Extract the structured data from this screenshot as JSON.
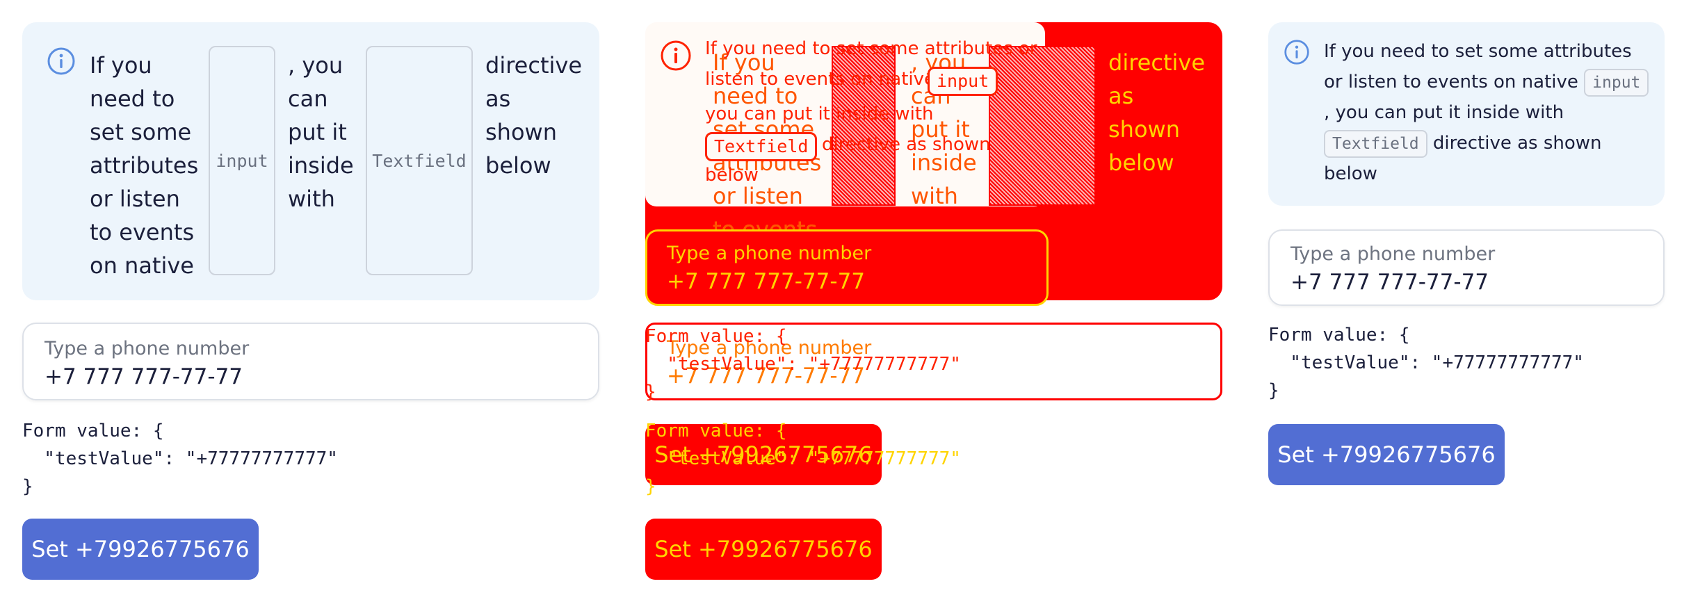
{
  "colors": {
    "notification_bg": "#edf5fc",
    "accent": "#526ed3",
    "info_icon": "#5b8ee0",
    "debug_red": "#ff0000",
    "debug_yellow": "#ffd400"
  },
  "icons": {
    "info": "info-circle-icon"
  },
  "narrow": {
    "notification": {
      "col1": "If you\nneed to\nset some\nattributes\nor listen\nto events\non native",
      "code1": "input",
      "col2": ", you\ncan\nput it\ninside\nwith",
      "code2": "Textfield",
      "col3": "directive\nas\nshown\nbelow"
    },
    "phone_field": {
      "label": "Type a phone number",
      "value": "+7 777 777-77-77"
    },
    "form_value": "Form value: {\n  \"testValue\": \"+77777777777\"\n}",
    "button_label": "Set +79926775676"
  },
  "overlay": {
    "notification_line1": "If you need to set some attributes or",
    "notification_line2a": "listen to events on native",
    "notification_code1": "input",
    "notification_line3": "you can put it inside with",
    "notification_code2": "Textfield",
    "notification_line4a": "directive as shown",
    "notification_line5": "below",
    "col1": "If you\nneed to\nset some\nattributes\nor listen\nto events\non native",
    "code1": "input",
    "col2": ", you\ncan\nput it\ninside\nwith",
    "code2": "Textfield",
    "col3": "directive\nas\nshown\nbelow",
    "phone_label": "Type a phone number",
    "phone_value": "+7 777 777-77-77",
    "form_value": "Form value: {\n  \"testValue\": \"+77777777777\"\n}",
    "button_label": "Set +79926775676"
  },
  "wide": {
    "notification": {
      "text_before_code1": "If you need to set some attributes or listen to events on native",
      "code1": "input",
      "text_before_code2": ", you can put it inside with",
      "code2": "Textfield",
      "text_after": "directive as shown below"
    },
    "phone_field": {
      "label": "Type a phone number",
      "value": "+7 777 777-77-77"
    },
    "form_value": "Form value: {\n  \"testValue\": \"+77777777777\"\n}",
    "button_label": "Set +79926775676"
  }
}
